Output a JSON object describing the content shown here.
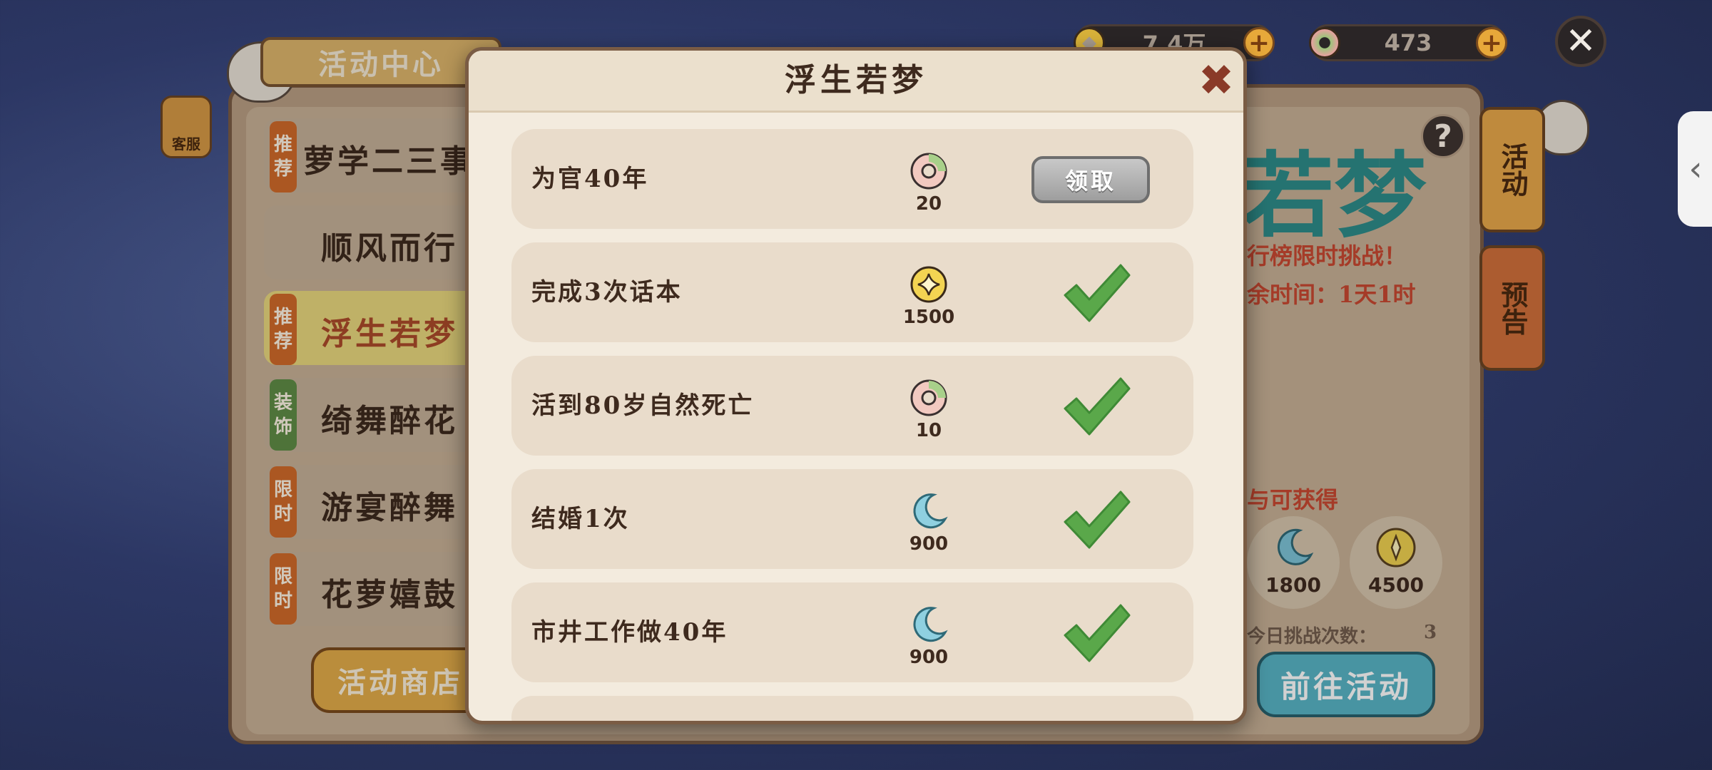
{
  "currency": {
    "coins": "7.4万",
    "jade": "473"
  },
  "activity_center": {
    "title": "活动中心",
    "customer_service": "客服",
    "sidebar": [
      {
        "tag": "推荐",
        "label": "萝学二三事"
      },
      {
        "tag": "",
        "label": "顺风而行"
      },
      {
        "tag": "推荐",
        "label": "浮生若梦",
        "active": true
      },
      {
        "tag": "装饰",
        "label": "绮舞醉花"
      },
      {
        "tag": "限时",
        "label": "游宴醉舞"
      },
      {
        "tag": "限时",
        "label": "花萝嬉鼓"
      }
    ],
    "shop_button": "活动商店",
    "banner_title": "若梦",
    "subtitle": "行榜限时挑战！",
    "remaining_time": "余时间：1天1时",
    "rewards_heading": "与可获得",
    "reward_values": [
      "1800",
      "4500"
    ],
    "challenges_text": "今日挑战次数：",
    "challenges_count": "3",
    "go_button": "前往活动",
    "tabs": [
      "活动",
      "预告"
    ],
    "help": "?"
  },
  "modal": {
    "title": "浮生若梦",
    "tasks": [
      {
        "name": "为官40年",
        "reward_icon": "jade-ring-icon",
        "reward": "20",
        "status": "claim",
        "claim_label": "领取"
      },
      {
        "name": "完成3次话本",
        "reward_icon": "gold-coin-icon",
        "reward": "1500",
        "status": "done"
      },
      {
        "name": "活到80岁自然死亡",
        "reward_icon": "jade-ring-icon",
        "reward": "10",
        "status": "done"
      },
      {
        "name": "结婚1次",
        "reward_icon": "moon-icon",
        "reward": "900",
        "status": "done"
      },
      {
        "name": "市井工作做40年",
        "reward_icon": "moon-icon",
        "reward": "900",
        "status": "done"
      }
    ]
  }
}
